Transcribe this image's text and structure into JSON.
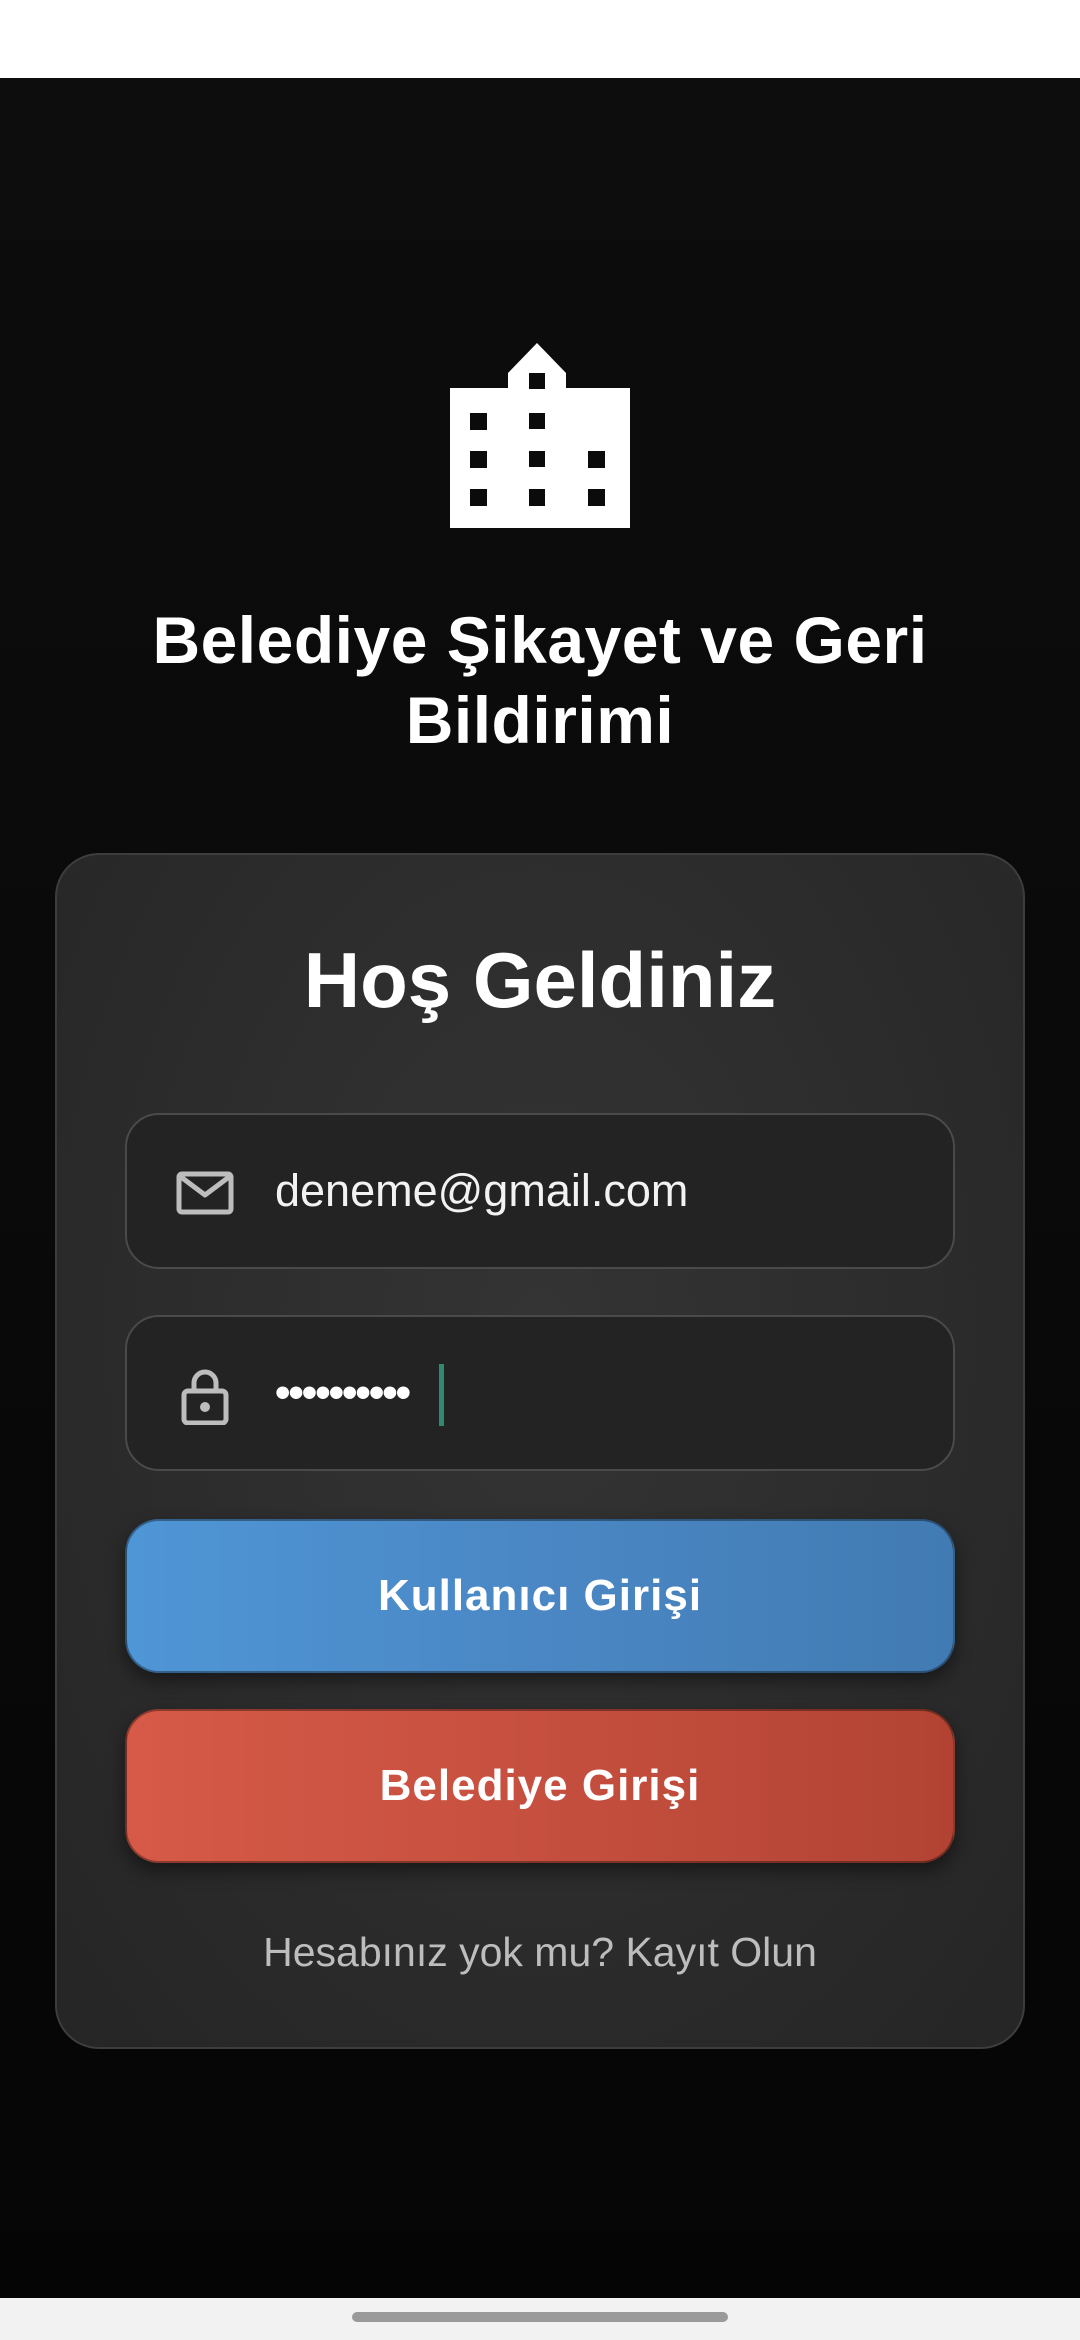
{
  "app": {
    "logo_icon": "building-icon",
    "title_line1": "Belediye Şikayet ve Geri",
    "title_line2": "Bildirimi"
  },
  "login_card": {
    "heading": "Hoş Geldiniz",
    "email_field": {
      "icon": "mail-icon",
      "value": "deneme@gmail.com"
    },
    "password_field": {
      "icon": "lock-icon",
      "masked_value": "••••••••••"
    },
    "user_login_label": "Kullanıcı Girişi",
    "municipality_login_label": "Belediye Girişi",
    "register_prompt": "Hesabınız yok mu? Kayıt Olun"
  },
  "colors": {
    "background": "#0a0a0a",
    "card": "#2e2e2e",
    "user_button": "#4a87c4",
    "municipality_button": "#c44e3e",
    "caret": "#2e8b72"
  }
}
